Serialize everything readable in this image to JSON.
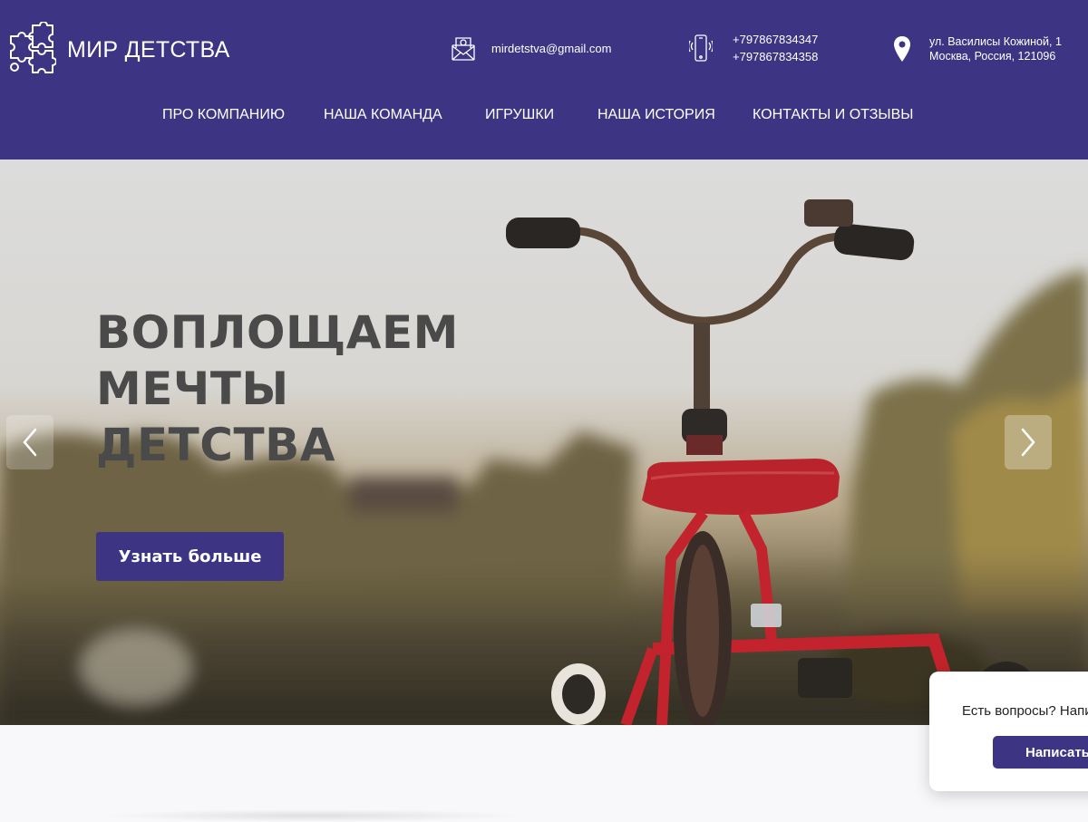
{
  "brand": {
    "name": "МИР ДЕТСТВА",
    "icon": "puzzle-icon"
  },
  "contacts": {
    "email": "mirdetstva@gmail.com",
    "email_icon": "envelope-icon",
    "phones": [
      "+797867834347",
      "+797867834358"
    ],
    "phone_icon": "smartphone-icon",
    "address_line1": "ул. Василисы Кожиной, 1",
    "address_line2": "Москва, Россия, 121096",
    "address_icon": "map-pin-icon"
  },
  "nav": {
    "items": [
      {
        "label": "ПРО КОМПАНИЮ"
      },
      {
        "label": "НАША КОМАНДА"
      },
      {
        "label": "ИГРУШКИ"
      },
      {
        "label": "НАША ИСТОРИЯ"
      },
      {
        "label": "КОНТАКТЫ И ОТЗЫВЫ"
      }
    ]
  },
  "hero": {
    "title_line1": "ВОПЛОЩАЕМ МЕЧТЫ",
    "title_line2": "ДЕТСТВА",
    "button_label": "Узнать больше",
    "image": "red-tricycle-photo",
    "prev_icon": "chevron-left-icon",
    "next_icon": "chevron-right-icon"
  },
  "chat_widget": {
    "text": "Есть вопросы? Напи",
    "button_label": "Написать"
  },
  "colors": {
    "brand_purple": "#3d3484",
    "title_gray": "#4a4a4a",
    "white": "#ffffff"
  }
}
